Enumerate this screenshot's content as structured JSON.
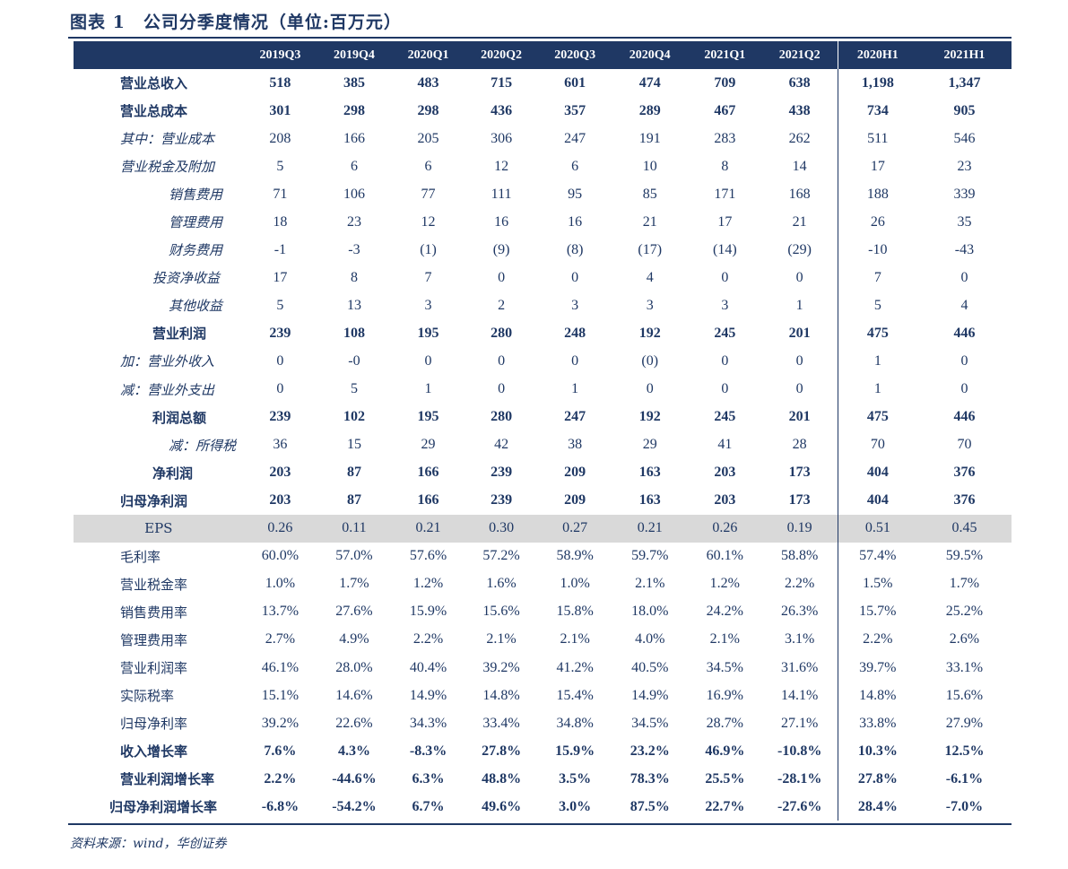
{
  "figure": {
    "title": "图表 1　公司分季度情况（单位:百万元）",
    "source": "资料来源：wind，华创证券"
  },
  "table": {
    "columns": [
      "2019Q3",
      "2019Q4",
      "2020Q1",
      "2020Q2",
      "2020Q3",
      "2020Q4",
      "2021Q1",
      "2021Q2",
      "2020H1",
      "2021H1"
    ],
    "rows": [
      {
        "label": "营业总收入",
        "style": "bold",
        "indent": 1,
        "values": [
          "518",
          "385",
          "483",
          "715",
          "601",
          "474",
          "709",
          "638",
          "1,198",
          "1,347"
        ]
      },
      {
        "label": "营业总成本",
        "style": "bold",
        "indent": 1,
        "values": [
          "301",
          "298",
          "298",
          "436",
          "357",
          "289",
          "467",
          "438",
          "734",
          "905"
        ]
      },
      {
        "label": "其中：营业成本",
        "style": "it",
        "indent": 1,
        "values": [
          "208",
          "166",
          "205",
          "306",
          "247",
          "191",
          "283",
          "262",
          "511",
          "546"
        ]
      },
      {
        "label": "营业税金及附加",
        "style": "it",
        "indent": 1,
        "values": [
          "5",
          "6",
          "6",
          "12",
          "6",
          "10",
          "8",
          "14",
          "17",
          "23"
        ]
      },
      {
        "label": "销售费用",
        "style": "it",
        "indent": 3,
        "values": [
          "71",
          "106",
          "77",
          "111",
          "95",
          "85",
          "171",
          "168",
          "188",
          "339"
        ]
      },
      {
        "label": "管理费用",
        "style": "it",
        "indent": 3,
        "values": [
          "18",
          "23",
          "12",
          "16",
          "16",
          "21",
          "17",
          "21",
          "26",
          "35"
        ]
      },
      {
        "label": "财务费用",
        "style": "it",
        "indent": 3,
        "values": [
          "-1",
          "-3",
          "(1)",
          "(9)",
          "(8)",
          "(17)",
          "(14)",
          "(29)",
          "-10",
          "-43"
        ]
      },
      {
        "label": "投资净收益",
        "style": "it",
        "indent": 2,
        "values": [
          "17",
          "8",
          "7",
          "0",
          "0",
          "4",
          "0",
          "0",
          "7",
          "0"
        ]
      },
      {
        "label": "其他收益",
        "style": "it",
        "indent": 3,
        "values": [
          "5",
          "13",
          "3",
          "2",
          "3",
          "3",
          "3",
          "1",
          "5",
          "4"
        ]
      },
      {
        "label": "营业利润",
        "style": "bold",
        "indent": 2,
        "values": [
          "239",
          "108",
          "195",
          "280",
          "248",
          "192",
          "245",
          "201",
          "475",
          "446"
        ]
      },
      {
        "label": "加：营业外收入",
        "style": "it",
        "indent": 1,
        "values": [
          "0",
          "-0",
          "0",
          "0",
          "0",
          "(0)",
          "0",
          "0",
          "1",
          "0"
        ]
      },
      {
        "label": "减：营业外支出",
        "style": "it",
        "indent": 1,
        "values": [
          "0",
          "5",
          "1",
          "0",
          "1",
          "0",
          "0",
          "0",
          "1",
          "0"
        ]
      },
      {
        "label": "利润总额",
        "style": "bold",
        "indent": 2,
        "values": [
          "239",
          "102",
          "195",
          "280",
          "247",
          "192",
          "245",
          "201",
          "475",
          "446"
        ]
      },
      {
        "label": "减：所得税",
        "style": "it",
        "indent": 3,
        "values": [
          "36",
          "15",
          "29",
          "42",
          "38",
          "29",
          "41",
          "28",
          "70",
          "70"
        ]
      },
      {
        "label": "净利润",
        "style": "bold",
        "indent": 2,
        "values": [
          "203",
          "87",
          "166",
          "239",
          "209",
          "163",
          "203",
          "173",
          "404",
          "376"
        ]
      },
      {
        "label": "归母净利润",
        "style": "bold",
        "indent": 1,
        "values": [
          "203",
          "87",
          "166",
          "239",
          "209",
          "163",
          "203",
          "173",
          "404",
          "376"
        ]
      },
      {
        "label": "EPS",
        "style": "eps",
        "indent": 1,
        "values": [
          "0.26",
          "0.11",
          "0.21",
          "0.30",
          "0.27",
          "0.21",
          "0.26",
          "0.19",
          "0.51",
          "0.45"
        ]
      },
      {
        "label": "毛利率",
        "style": "plain",
        "indent": 1,
        "values": [
          "60.0%",
          "57.0%",
          "57.6%",
          "57.2%",
          "58.9%",
          "59.7%",
          "60.1%",
          "58.8%",
          "57.4%",
          "59.5%"
        ]
      },
      {
        "label": "营业税金率",
        "style": "plain",
        "indent": 1,
        "values": [
          "1.0%",
          "1.7%",
          "1.2%",
          "1.6%",
          "1.0%",
          "2.1%",
          "1.2%",
          "2.2%",
          "1.5%",
          "1.7%"
        ]
      },
      {
        "label": "销售费用率",
        "style": "plain",
        "indent": 1,
        "values": [
          "13.7%",
          "27.6%",
          "15.9%",
          "15.6%",
          "15.8%",
          "18.0%",
          "24.2%",
          "26.3%",
          "15.7%",
          "25.2%"
        ]
      },
      {
        "label": "管理费用率",
        "style": "plain",
        "indent": 1,
        "values": [
          "2.7%",
          "4.9%",
          "2.2%",
          "2.1%",
          "2.1%",
          "4.0%",
          "2.1%",
          "3.1%",
          "2.2%",
          "2.6%"
        ]
      },
      {
        "label": "营业利润率",
        "style": "plain",
        "indent": 1,
        "values": [
          "46.1%",
          "28.0%",
          "40.4%",
          "39.2%",
          "41.2%",
          "40.5%",
          "34.5%",
          "31.6%",
          "39.7%",
          "33.1%"
        ]
      },
      {
        "label": "实际税率",
        "style": "plain",
        "indent": 1,
        "values": [
          "15.1%",
          "14.6%",
          "14.9%",
          "14.8%",
          "15.4%",
          "14.9%",
          "16.9%",
          "14.1%",
          "14.8%",
          "15.6%"
        ]
      },
      {
        "label": "归母净利率",
        "style": "plain",
        "indent": 1,
        "values": [
          "39.2%",
          "22.6%",
          "34.3%",
          "33.4%",
          "34.8%",
          "34.5%",
          "28.7%",
          "27.1%",
          "33.8%",
          "27.9%"
        ]
      },
      {
        "label": "收入增长率",
        "style": "bold",
        "indent": 1,
        "values": [
          "7.6%",
          "4.3%",
          "-8.3%",
          "27.8%",
          "15.9%",
          "23.2%",
          "46.9%",
          "-10.8%",
          "10.3%",
          "12.5%"
        ]
      },
      {
        "label": "营业利润增长率",
        "style": "bold",
        "indent": 1,
        "values": [
          "2.2%",
          "-44.6%",
          "6.3%",
          "48.8%",
          "3.5%",
          "78.3%",
          "25.5%",
          "-28.1%",
          "27.8%",
          "-6.1%"
        ]
      },
      {
        "label": "归母净利润增长率",
        "style": "bold",
        "indent": 0,
        "values": [
          "-6.8%",
          "-54.2%",
          "6.7%",
          "49.6%",
          "3.0%",
          "87.5%",
          "22.7%",
          "-27.6%",
          "28.4%",
          "-7.0%"
        ]
      }
    ]
  }
}
